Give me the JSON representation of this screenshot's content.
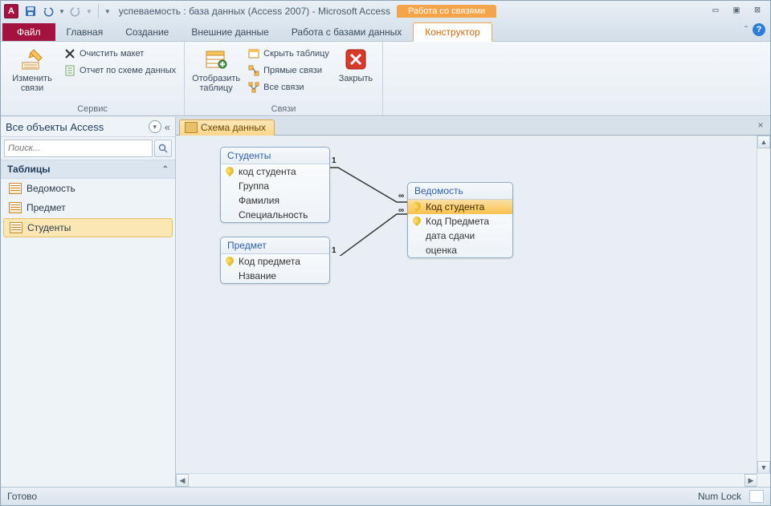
{
  "titlebar": {
    "app_letter": "A",
    "title": "успеваемость : база данных (Access 2007)  -  Microsoft Access",
    "context_title": "Работа со связями"
  },
  "tabs": {
    "file": "Файл",
    "items": [
      "Главная",
      "Создание",
      "Внешние данные",
      "Работа с базами данных"
    ],
    "context": "Конструктор"
  },
  "ribbon": {
    "group_service": {
      "edit_relations": "Изменить связи",
      "clear_layout": "Очистить макет",
      "report": "Отчет по схеме данных",
      "label": "Сервис"
    },
    "group_relations": {
      "show_table": "Отобразить таблицу",
      "hide_table": "Скрыть таблицу",
      "direct": "Прямые связи",
      "all": "Все связи",
      "close": "Закрыть",
      "label": "Связи"
    }
  },
  "nav": {
    "header": "Все объекты Access",
    "search_placeholder": "Поиск...",
    "category": "Таблицы",
    "items": [
      "Ведомость",
      "Предмет",
      "Студенты"
    ]
  },
  "doc": {
    "tab": "Схема данных"
  },
  "tables": {
    "students": {
      "title": "Студенты",
      "fields": [
        {
          "name": "код студента",
          "key": true
        },
        {
          "name": "Группа",
          "key": false
        },
        {
          "name": "Фамилия",
          "key": false
        },
        {
          "name": "Специальность",
          "key": false
        }
      ]
    },
    "subject": {
      "title": "Предмет",
      "fields": [
        {
          "name": "Код предмета",
          "key": true
        },
        {
          "name": "Нзвание",
          "key": false
        }
      ]
    },
    "sheet": {
      "title": "Ведомость",
      "fields": [
        {
          "name": "Код студента",
          "key": true,
          "sel": true
        },
        {
          "name": "Код Предмета",
          "key": true
        },
        {
          "name": "дата сдачи",
          "key": false
        },
        {
          "name": "оценка",
          "key": false
        }
      ]
    }
  },
  "rel_labels": {
    "one": "1",
    "many": "∞"
  },
  "status": {
    "ready": "Готово",
    "numlock": "Num Lock"
  }
}
